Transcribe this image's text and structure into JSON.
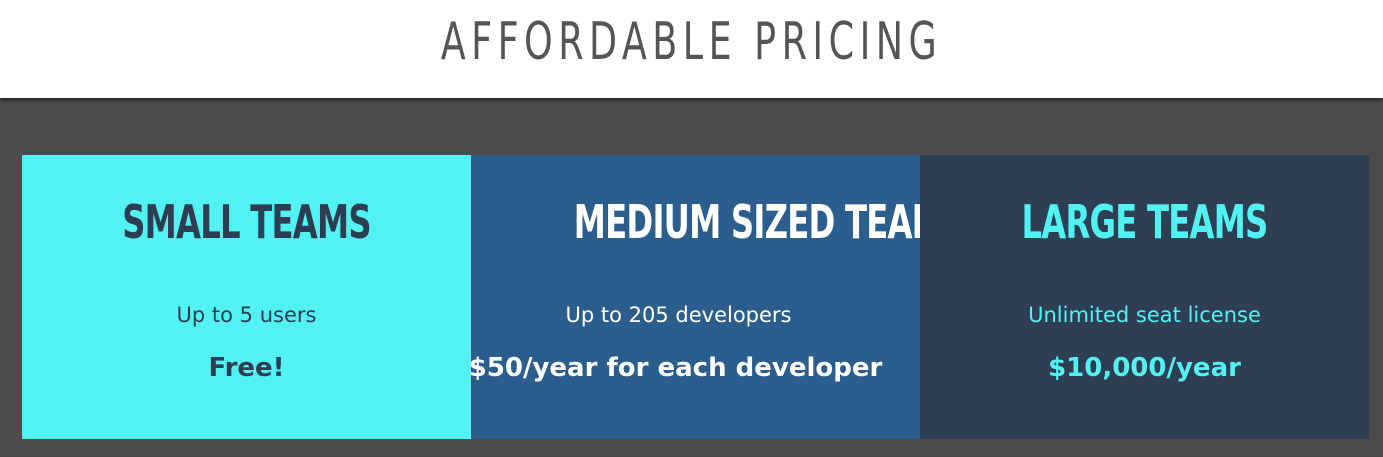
{
  "header": {
    "title": "AFFORDABLE PRICING"
  },
  "plans": [
    {
      "title": "SMALL TEAMS",
      "description": "Up to 5 users",
      "price": "Free!"
    },
    {
      "title": "MEDIUM SIZED TEAMS",
      "description": "Up to 205 developers",
      "price": "$50/year for each developer"
    },
    {
      "title": "LARGE TEAMS",
      "description": "Unlimited seat license",
      "price": "$10,000/year"
    }
  ],
  "colors": {
    "header_bg": "#ffffff",
    "header_text": "#555555",
    "background": "#4a4a4a",
    "small_bg": "#52f2f3",
    "small_text": "#2e3e52",
    "medium_bg": "#2b5e8c",
    "medium_text": "#ffffff",
    "large_bg": "#2e3f54",
    "large_text": "#52f2f3"
  }
}
